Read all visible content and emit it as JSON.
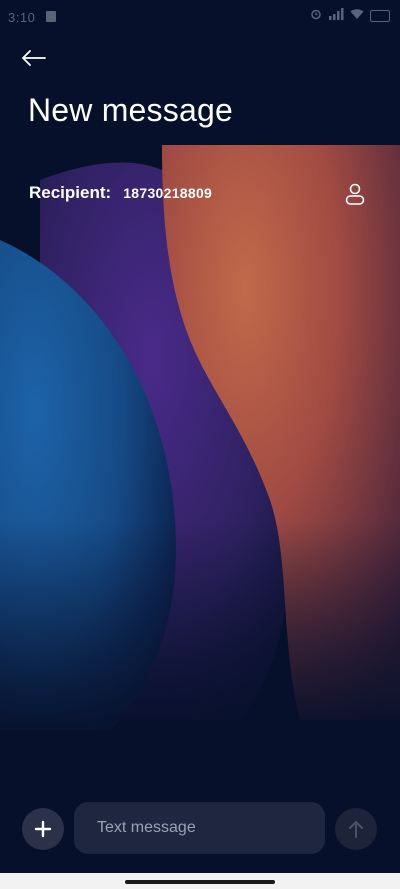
{
  "status_bar": {
    "time": "3:10",
    "icons": [
      "alarm-icon",
      "signal-icon",
      "wifi-icon",
      "battery-icon"
    ]
  },
  "header": {
    "back_icon": "arrow-left-icon",
    "title": "New message"
  },
  "recipient": {
    "label": "Recipient:",
    "value": "18730218809",
    "contact_icon": "person-icon"
  },
  "composer": {
    "add_icon": "plus-icon",
    "placeholder": "Text message",
    "value": "",
    "send_icon": "arrow-up-icon"
  },
  "colors": {
    "background": "#06102a",
    "text": "#ffffff",
    "input_bg": "#1f2740",
    "placeholder": "#9aa2b4",
    "add_button_bg": "#2a3148",
    "send_button_bg": "#1d2339"
  }
}
